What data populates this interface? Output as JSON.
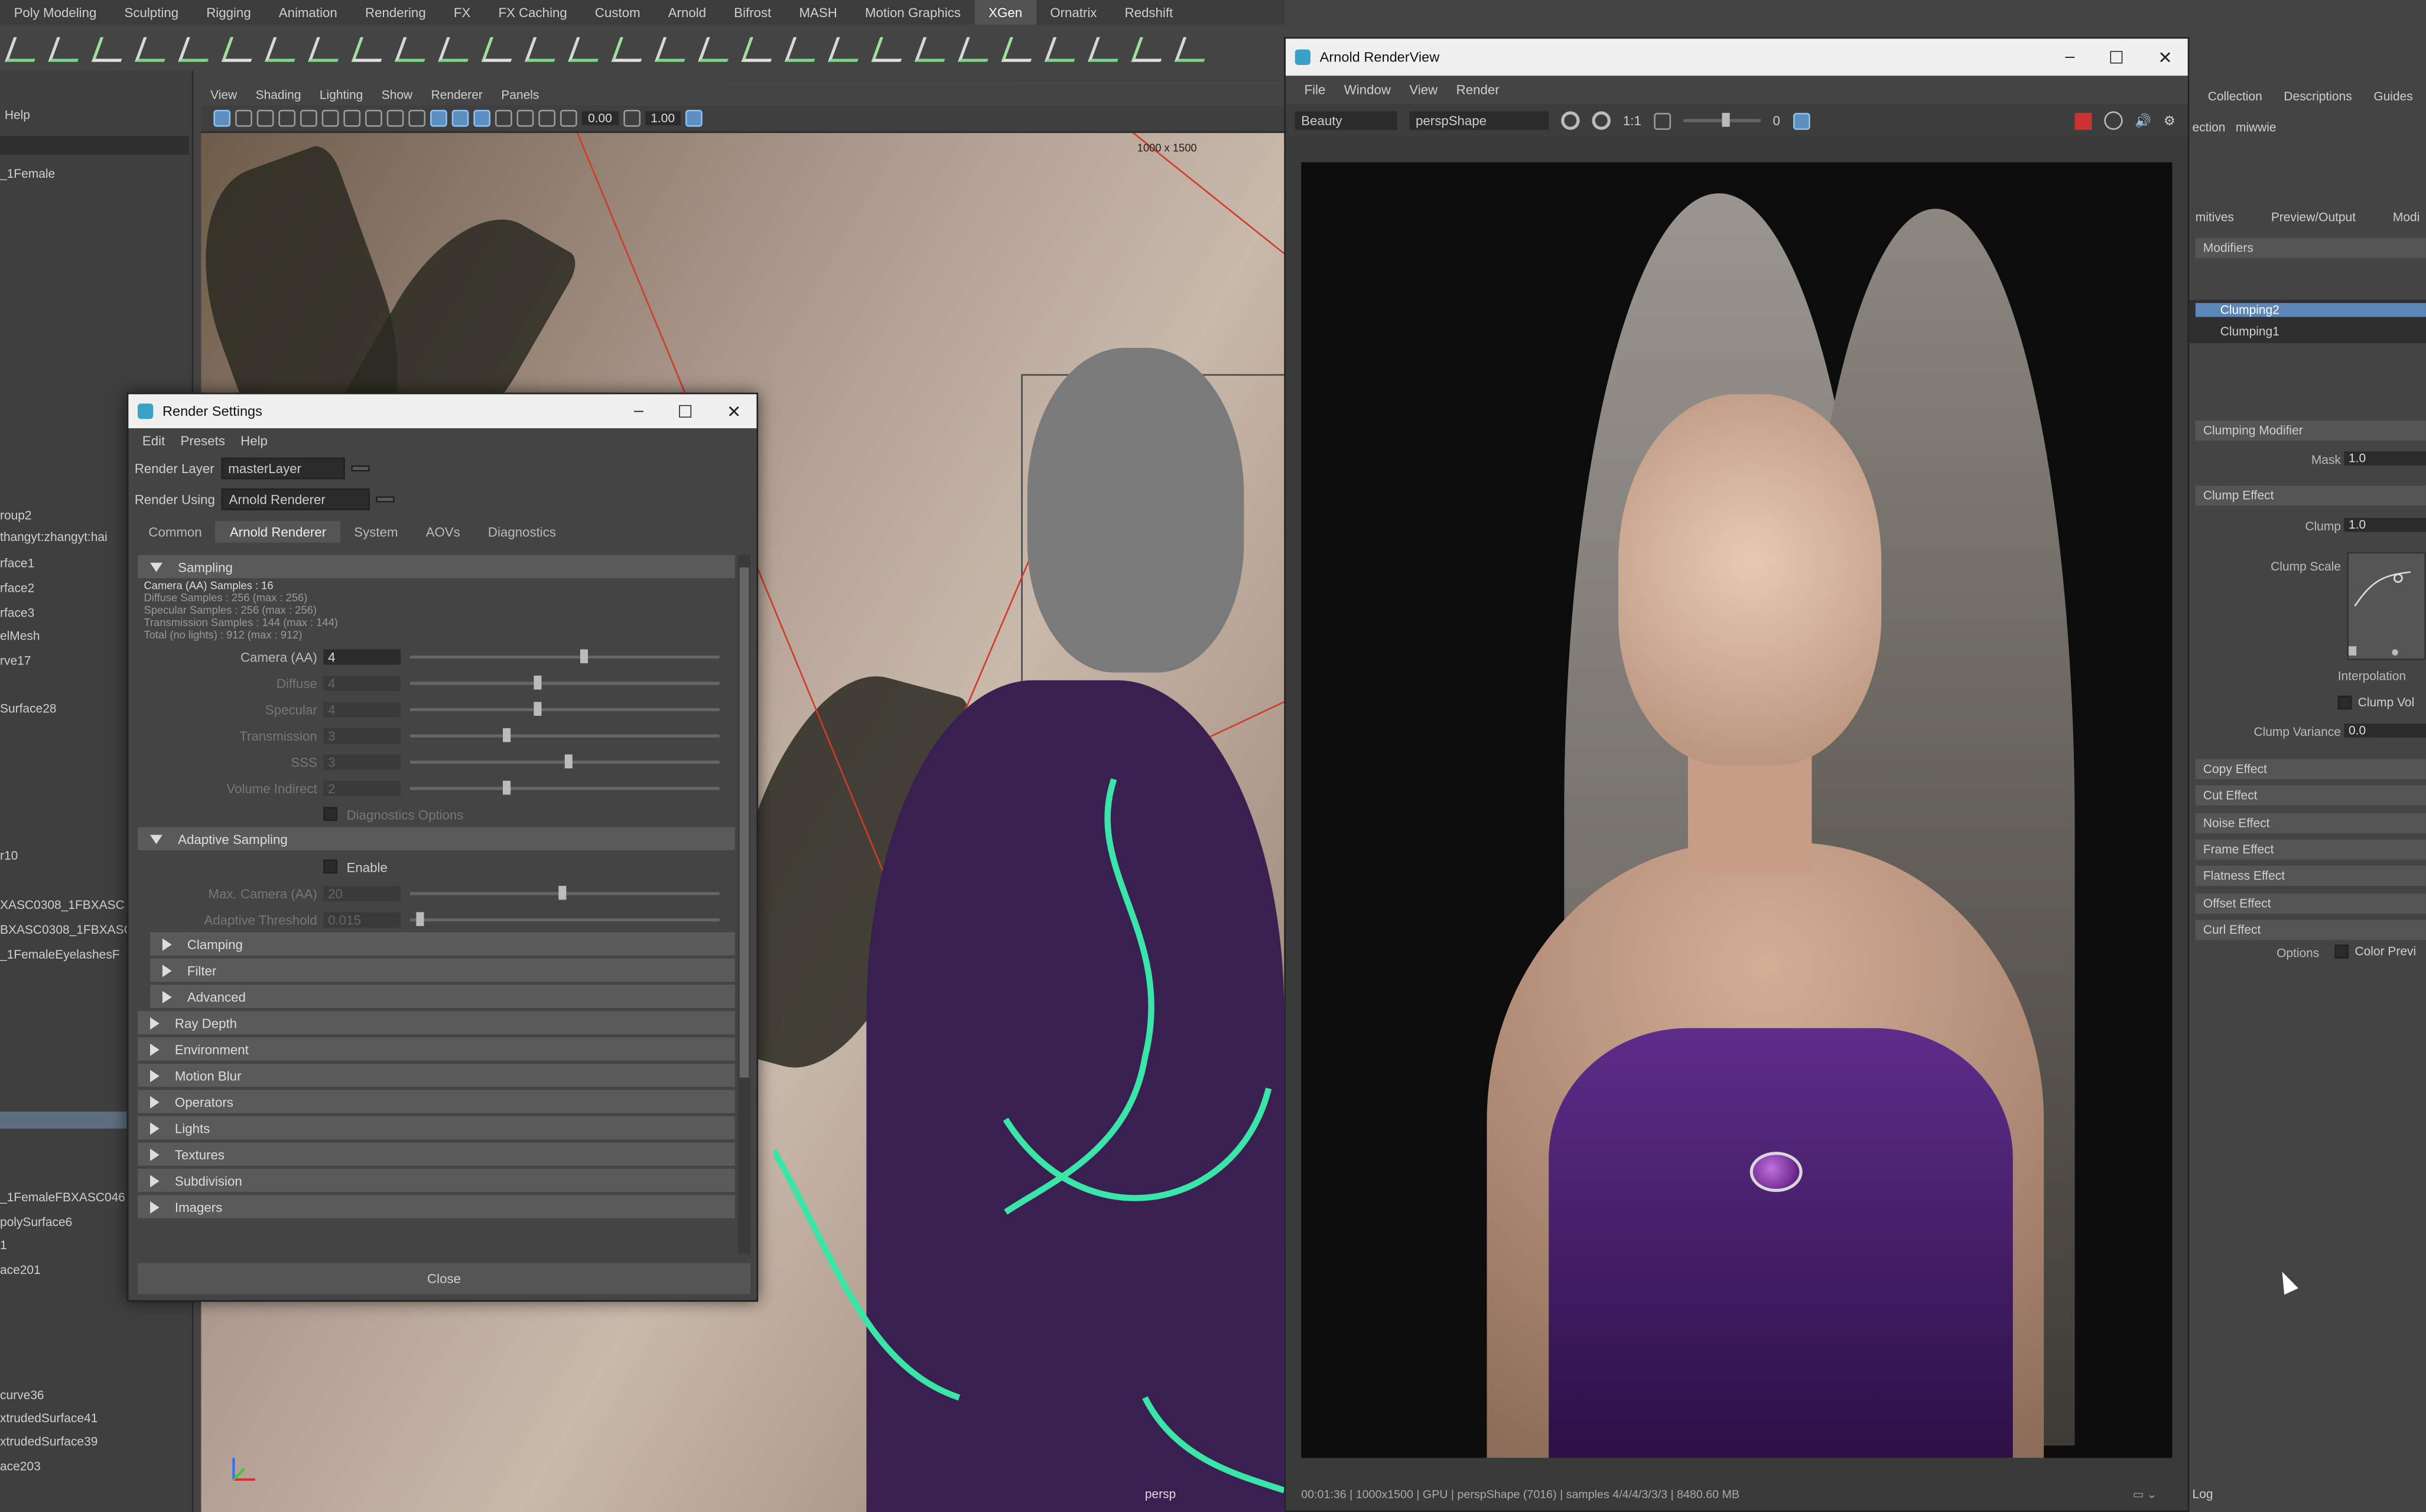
{
  "shelf": {
    "tabs": [
      "Poly Modeling",
      "Sculpting",
      "Rigging",
      "Animation",
      "Rendering",
      "FX",
      "FX Caching",
      "Custom",
      "Arnold",
      "Bifrost",
      "MASH",
      "Motion Graphics",
      "XGen",
      "Ornatrix",
      "Redshift"
    ],
    "active_tab": "XGen"
  },
  "outliner": {
    "help": "Help",
    "rows": [
      "_1Female",
      "roup2",
      "thangyt:zhangyt:hai",
      "rface1",
      "rface2",
      "rface3",
      "elMesh",
      "rve17",
      "Surface28",
      "r10",
      "XASC0308_1FBXASC",
      "BXASC0308_1FBXASC",
      "_1FemaleEyelashesF",
      "_1FemaleFBXASC046",
      "polySurface6",
      "1",
      "ace201",
      "curve36",
      "xtrudedSurface41",
      "xtrudedSurface39",
      "ace203"
    ]
  },
  "viewport": {
    "menu": [
      "View",
      "Shading",
      "Lighting",
      "Show",
      "Renderer",
      "Panels"
    ],
    "val1": "0.00",
    "val2": "1.00",
    "resolution": "1000 x 1500",
    "camera_label": "persp"
  },
  "render_settings": {
    "title": "Render Settings",
    "menu": [
      "Edit",
      "Presets",
      "Help"
    ],
    "render_layer_label": "Render Layer",
    "render_layer_value": "masterLayer",
    "render_using_label": "Render Using",
    "render_using_value": "Arnold Renderer",
    "tabs": [
      "Common",
      "Arnold Renderer",
      "System",
      "AOVs",
      "Diagnostics"
    ],
    "active_tab": "Arnold Renderer",
    "sampling": {
      "title": "Sampling",
      "info": [
        "Camera (AA) Samples : 16",
        "Diffuse Samples : 256 (max : 256)",
        "Specular Samples : 256 (max : 256)",
        "Transmission Samples : 144 (max : 144)",
        "Total (no lights) : 912 (max : 912)"
      ],
      "sliders": [
        {
          "label": "Camera (AA)",
          "value": "4",
          "knob": 0.55,
          "enabled": true
        },
        {
          "label": "Diffuse",
          "value": "4",
          "knob": 0.4,
          "enabled": false
        },
        {
          "label": "Specular",
          "value": "4",
          "knob": 0.4,
          "enabled": false
        },
        {
          "label": "Transmission",
          "value": "3",
          "knob": 0.3,
          "enabled": false
        },
        {
          "label": "SSS",
          "value": "3",
          "knob": 0.5,
          "enabled": false
        },
        {
          "label": "Volume Indirect",
          "value": "2",
          "knob": 0.3,
          "enabled": false
        }
      ],
      "diag_label": "Diagnostics Options"
    },
    "adaptive": {
      "title": "Adaptive Sampling",
      "enable_label": "Enable",
      "max_label": "Max. Camera (AA)",
      "max_value": "20",
      "threshold_label": "Adaptive Threshold",
      "threshold_value": "0.015"
    },
    "sub_sections": [
      "Clamping",
      "Filter",
      "Advanced"
    ],
    "sections": [
      "Ray Depth",
      "Environment",
      "Motion Blur",
      "Operators",
      "Lights",
      "Textures",
      "Subdivision",
      "Imagers"
    ],
    "close_label": "Close"
  },
  "arnold_renderview": {
    "title": "Arnold RenderView",
    "menu": [
      "File",
      "Window",
      "View",
      "Render"
    ],
    "aov": "Beauty",
    "camera": "perspShape",
    "ratio": "1:1",
    "exposure": "0",
    "status": "00:01:36 | 1000x1500 | GPU | perspShape (7016) | samples 4/4/4/3/3/3 | 8480.60 MB"
  },
  "attribute_editor": {
    "tabs": [
      "Collection",
      "Descriptions",
      "Guides"
    ],
    "subtabs": [
      "mitives",
      "Preview/Output",
      "Modi"
    ],
    "sub_label": "ection",
    "sub_value": "miwwie",
    "modifiers_header": "Modifiers",
    "list": [
      "Clumping2",
      "Clumping1"
    ],
    "clumping_modifier": "Clumping Modifier",
    "mask_label": "Mask",
    "mask_value": "1.0",
    "clump_effect": "Clump Effect",
    "clump_label": "Clump",
    "clump_value": "1.0",
    "clump_scale_label": "Clump Scale",
    "interpolation_label": "Interpolation",
    "clump_vol_label": "Clump Vol",
    "clump_variance_label": "Clump Variance",
    "clump_variance_value": "0.0",
    "effects": [
      "Copy Effect",
      "Cut Effect",
      "Noise Effect",
      "Frame Effect",
      "Flatness Effect",
      "Offset Effect",
      "Curl Effect"
    ],
    "options_label": "Options",
    "color_preview_label": "Color Previ",
    "log_label": "Log"
  }
}
